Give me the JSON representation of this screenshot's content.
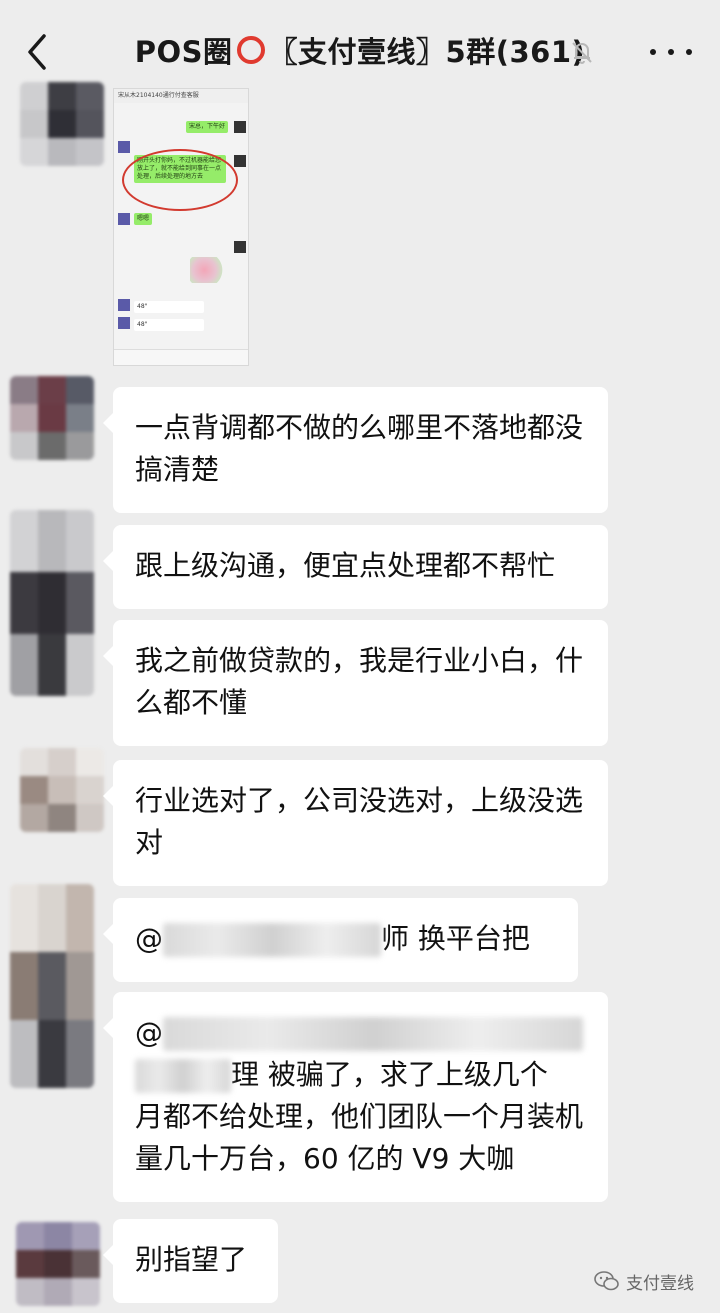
{
  "header": {
    "title_prefix": "POS圈",
    "title_suffix": "〖支付壹线〗5群(361)"
  },
  "screenshot_thumb": {
    "top_line": "宋从木2104140通行付查客服",
    "msg_right_1": "宋总，下午好",
    "msg_left_1": "刚开头打你妈，不过机器能给您放上了，就不能给到同事在一点处理，后续处理的地方去",
    "msg_left_2": "嗯嗯",
    "voice_1": "48\"",
    "voice_2": "48\""
  },
  "messages": [
    {
      "text": "一点背调都不做的么哪里不落地都没搞清楚"
    },
    {
      "text": "跟上级沟通，便宜点处理都不帮忙"
    },
    {
      "text": "我之前做贷款的，我是行业小白，什么都不懂"
    },
    {
      "text": "行业选对了，公司没选对，上级没选对"
    },
    {
      "prefix": "@",
      "suffix": "师  换平台把"
    },
    {
      "prefix": "@",
      "middle": "理  被骗了，求了上级几个",
      "rest": "月都不给处理，他们团队一个月装机量几十万台，60 亿的 V9 大咖"
    },
    {
      "text": "别指望了"
    }
  ],
  "watermark": {
    "label": "支付壹线"
  },
  "colors": {
    "background": "#ededed",
    "bubble": "#ffffff",
    "accent_red": "#e03a2f"
  }
}
